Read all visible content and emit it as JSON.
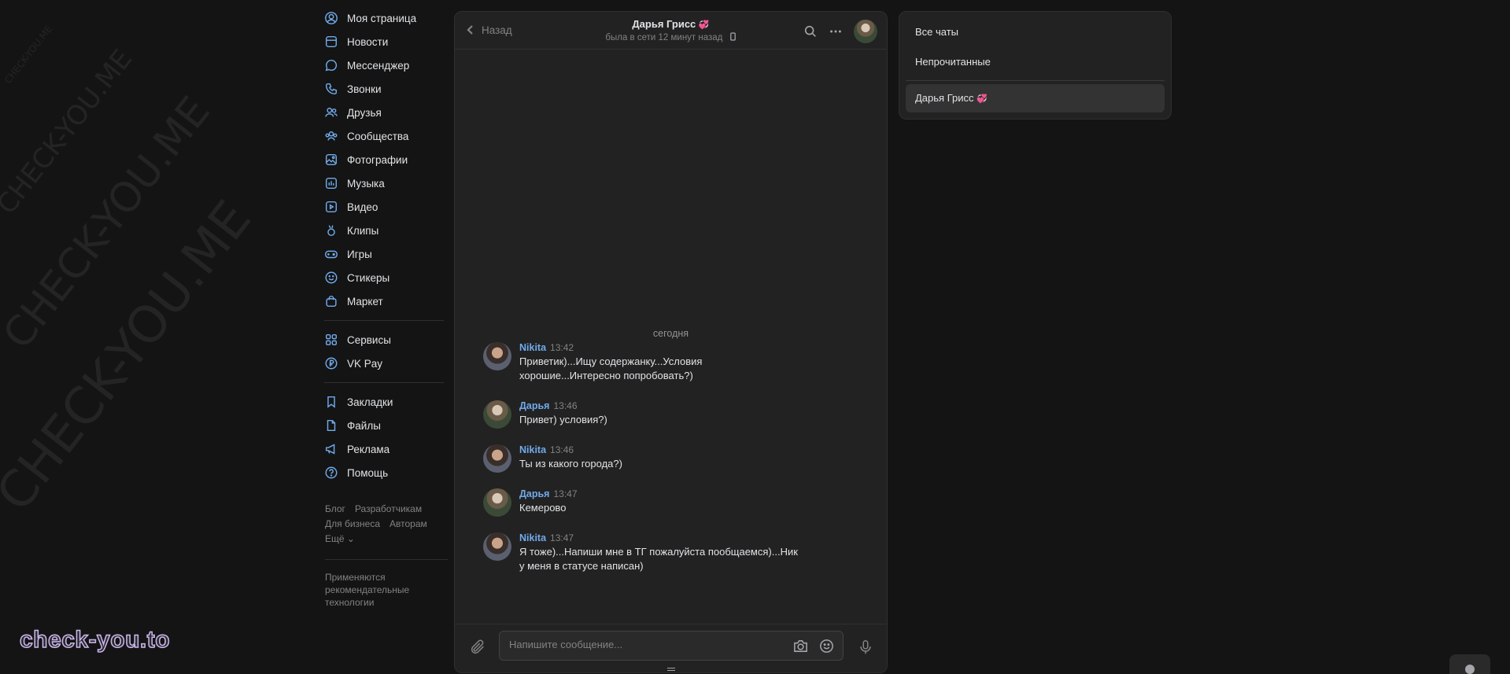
{
  "watermark": {
    "small": "CHECK-YOU.ME",
    "large": "CHECK-YOU.ME",
    "brand": "check-you.to"
  },
  "nav": {
    "items": [
      {
        "label": "Моя страница",
        "icon": "user-circle-icon"
      },
      {
        "label": "Новости",
        "icon": "news-icon"
      },
      {
        "label": "Мессенджер",
        "icon": "message-icon"
      },
      {
        "label": "Звонки",
        "icon": "phone-icon"
      },
      {
        "label": "Друзья",
        "icon": "friends-icon"
      },
      {
        "label": "Сообщества",
        "icon": "communities-icon"
      },
      {
        "label": "Фотографии",
        "icon": "photo-icon"
      },
      {
        "label": "Музыка",
        "icon": "music-icon"
      },
      {
        "label": "Видео",
        "icon": "video-icon"
      },
      {
        "label": "Клипы",
        "icon": "clips-icon"
      },
      {
        "label": "Игры",
        "icon": "gamepad-icon"
      },
      {
        "label": "Стикеры",
        "icon": "smile-icon"
      },
      {
        "label": "Маркет",
        "icon": "bag-icon"
      }
    ],
    "items2": [
      {
        "label": "Сервисы",
        "icon": "grid-icon"
      },
      {
        "label": "VK Pay",
        "icon": "ruble-icon"
      }
    ],
    "items3": [
      {
        "label": "Закладки",
        "icon": "bookmark-icon"
      },
      {
        "label": "Файлы",
        "icon": "file-icon"
      },
      {
        "label": "Реклама",
        "icon": "megaphone-icon"
      },
      {
        "label": "Помощь",
        "icon": "help-icon"
      }
    ]
  },
  "footer": {
    "links": [
      "Блог",
      "Разработчикам",
      "Для бизнеса",
      "Авторам",
      "Ещё ⌄"
    ],
    "note": "Применяются рекомендательные технологии"
  },
  "chat": {
    "back_label": "Назад",
    "peer_name": "Дарья Грисс",
    "peer_emoji": "💞",
    "peer_status": "была в сети 12 минут назад",
    "day_label": "сегодня",
    "messages": [
      {
        "author": "Nikita",
        "time": "13:42",
        "text": "Приветик)...Ищу содержанку...Условия хорошие...Интересно попробовать?)"
      },
      {
        "author": "Дарья",
        "time": "13:46",
        "text": "Привет) условия?)"
      },
      {
        "author": "Nikita",
        "time": "13:46",
        "text": "Ты из какого города?)"
      },
      {
        "author": "Дарья",
        "time": "13:47",
        "text": "Кемерово"
      },
      {
        "author": "Nikita",
        "time": "13:47",
        "text": "Я тоже)...Напиши мне в ТГ пожалуйста пообщаемся)...Ник у меня в статусе написан)"
      }
    ],
    "input_placeholder": "Напишите сообщение..."
  },
  "folders": {
    "all": "Все чаты",
    "unread": "Непрочитанные",
    "active_chat": "Дарья Грисс",
    "active_emoji": "💞"
  },
  "colors": {
    "accent": "#71aaeb",
    "background": "#141414",
    "panel": "#222222"
  }
}
